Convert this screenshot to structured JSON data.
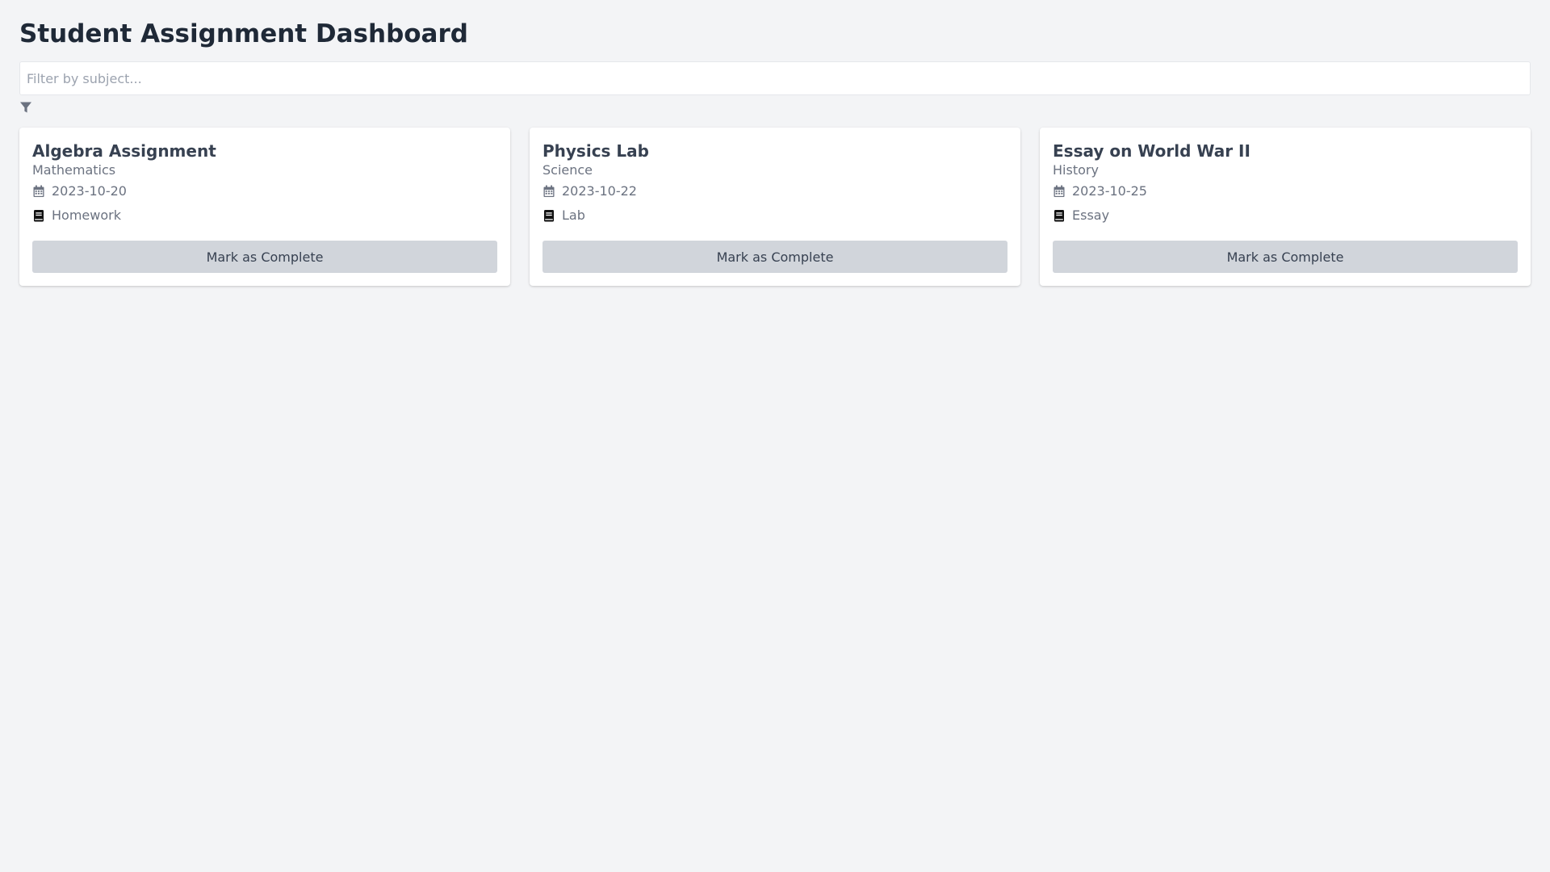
{
  "page": {
    "title": "Student Assignment Dashboard"
  },
  "filter": {
    "placeholder": "Filter by subject...",
    "value": "",
    "icon": "filter-icon"
  },
  "assignments": [
    {
      "title": "Algebra Assignment",
      "subject": "Mathematics",
      "due_date": "2023-10-20",
      "type": "Homework",
      "button_label": "Mark as Complete"
    },
    {
      "title": "Physics Lab",
      "subject": "Science",
      "due_date": "2023-10-22",
      "type": "Lab",
      "button_label": "Mark as Complete"
    },
    {
      "title": "Essay on World War II",
      "subject": "History",
      "due_date": "2023-10-25",
      "type": "Essay",
      "button_label": "Mark as Complete"
    }
  ],
  "icons": {
    "date": "calendar-icon",
    "type": "book-icon"
  },
  "colors": {
    "background": "#f3f4f6",
    "card": "#ffffff",
    "button": "#d1d5db",
    "title": "#1f2937",
    "muted": "#6b7280"
  }
}
